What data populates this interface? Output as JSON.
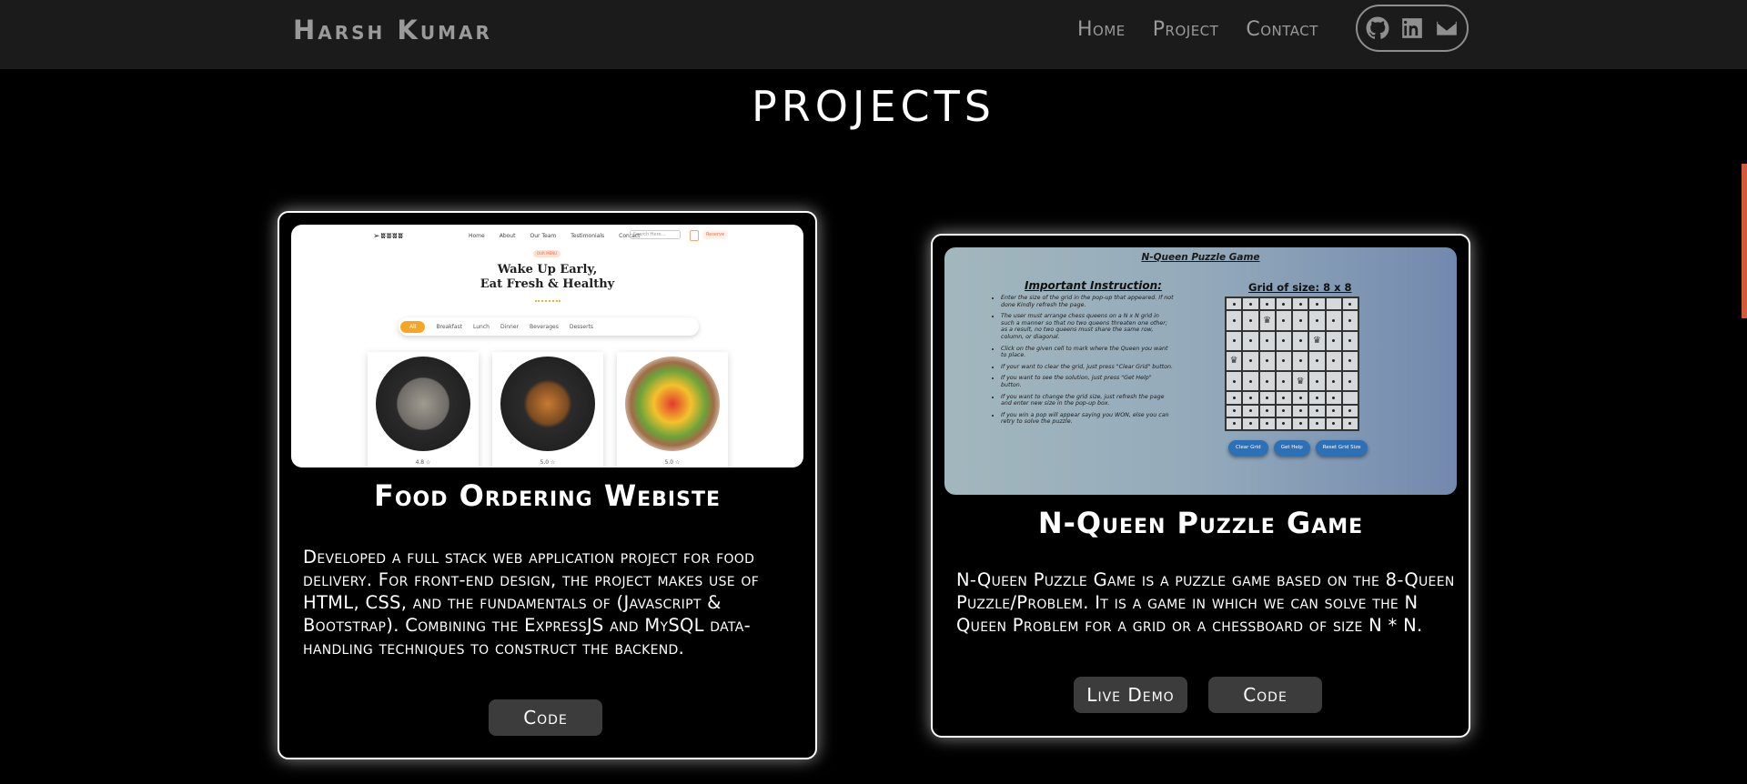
{
  "header": {
    "brand": "Harsh Kumar",
    "nav": [
      "Home",
      "Project",
      "Contact"
    ],
    "social_icons": [
      "github-icon",
      "linkedin-icon",
      "mail-icon"
    ]
  },
  "page": {
    "title": "PROJECTS"
  },
  "colors": {
    "background": "#000000",
    "navbar": "#1b1b1b",
    "button": "#3c3c3c",
    "accent": "#d15a3a"
  },
  "projects": [
    {
      "title": "Food Ordering Webiste",
      "description": "Developed a full stack web application project for food delivery. For front-end design, the project makes use of HTML, CSS, and the fundamentals of (Javascript & Bootstrap). Combining the ExpressJS and MySQL data-handling techniques to construct the backend.",
      "buttons": [
        "Code"
      ],
      "preview": {
        "logo": "➢ʬʬʬʬ",
        "nav": [
          "Home",
          "About",
          "Our Team",
          "Testimonials",
          "Contact"
        ],
        "search_placeholder": "Search Here...",
        "reserve": "Reserve",
        "badge": "OUR MENU",
        "hero": [
          "Wake Up Early,",
          "Eat Fresh & Healthy"
        ],
        "categories": [
          "All",
          "Breakfast",
          "Lunch",
          "Dinner",
          "Beverages",
          "Desserts"
        ],
        "ratings": [
          "4.8 ☆",
          "5.0 ☆",
          "5.0 ☆"
        ]
      }
    },
    {
      "title": "N-Queen Puzzle Game",
      "description": "N-Queen Puzzle Game is a puzzle game based on the 8-Queen Puzzle/Problem. It is a game in which we can solve the N Queen Problem for a grid or a chessboard of size N * N.",
      "buttons": [
        "Live Demo",
        "Code"
      ],
      "preview": {
        "title": "N-Queen Puzzle Game",
        "instruction_title": "Important Instruction:",
        "instructions": [
          "Enter the size of the grid in the pop-up that appeared. If not done Kindly refresh the page.",
          "The user must arrange chess queens on a N x N grid in such a manner so that no two queens threaten one other; as a result, no two queens must share the same row, column, or diagonal.",
          "Click on the given cell to mark where the Queen you want to place.",
          "If your want to clear the grid, just press \"Clear Grid\" button.",
          "If you want to see the solution, just press \"Get Help\" button.",
          "If you want to change the grid size, just refresh the page and enter new size in the pop-up box.",
          "If you win a pop will appear saying you WON, else you can retry to solve the puzzle."
        ],
        "grid_title": "Grid of size: 8 x 8",
        "buttons": [
          "Clear Grid",
          "Get Help",
          "Reset Grid Size"
        ]
      }
    }
  ]
}
